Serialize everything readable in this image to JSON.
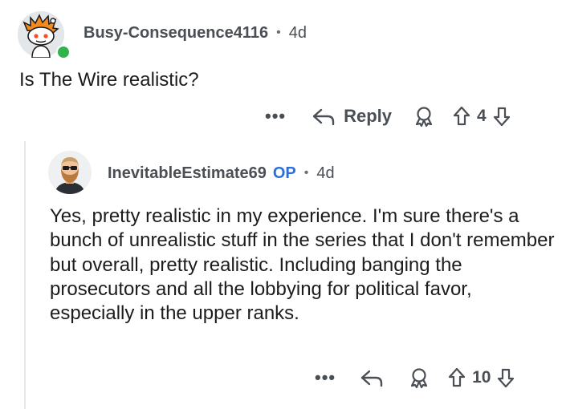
{
  "comment": {
    "username": "Busy-Consequence4116",
    "separator": "•",
    "age": "4d",
    "body": "Is The Wire realistic?",
    "actions": {
      "more": "•••",
      "reply_label": "Reply",
      "score": "4"
    },
    "icons": {
      "more": "more-dots-icon",
      "reply": "reply-arrow-icon",
      "award": "award-icon",
      "upvote": "upvote-arrow-icon",
      "downvote": "downvote-arrow-icon"
    }
  },
  "reply": {
    "username": "InevitableEstimate69",
    "op_badge": "OP",
    "separator": "•",
    "age": "4d",
    "body": "Yes, pretty realistic in my experience. I'm sure there's a bunch of unrealistic stuff in the series that I don't remember but overall, pretty realistic. Including banging the prosecutors and all the lobbying for political favor, especially in the upper ranks.",
    "actions": {
      "more": "•••",
      "score": "10"
    }
  },
  "colors": {
    "text": "#1c1c1c",
    "meta": "#4a4f55",
    "op": "#2a6fdb",
    "online": "#32b34a",
    "thread_line": "#e6e8ea"
  }
}
